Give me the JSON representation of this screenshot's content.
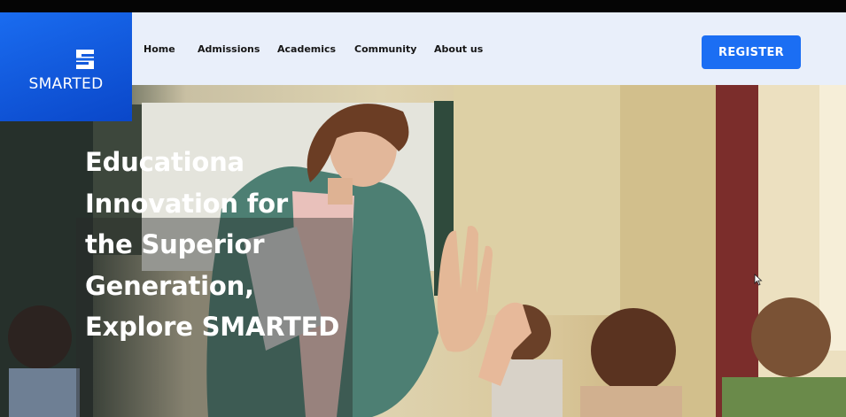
{
  "brand": {
    "name": "SMARTED",
    "logo_icon": "s-logo-icon",
    "color": "#1b6ef3"
  },
  "nav": {
    "items": [
      {
        "label": "Home"
      },
      {
        "label": "Admissions"
      },
      {
        "label": "Academics"
      },
      {
        "label": "Community"
      },
      {
        "label": "About us"
      }
    ]
  },
  "register": {
    "label": "REGISTER"
  },
  "hero": {
    "headline_lines": [
      "Educationa",
      "Innovation for",
      "the Superior",
      "Generation,",
      "Explore SMARTED"
    ]
  }
}
